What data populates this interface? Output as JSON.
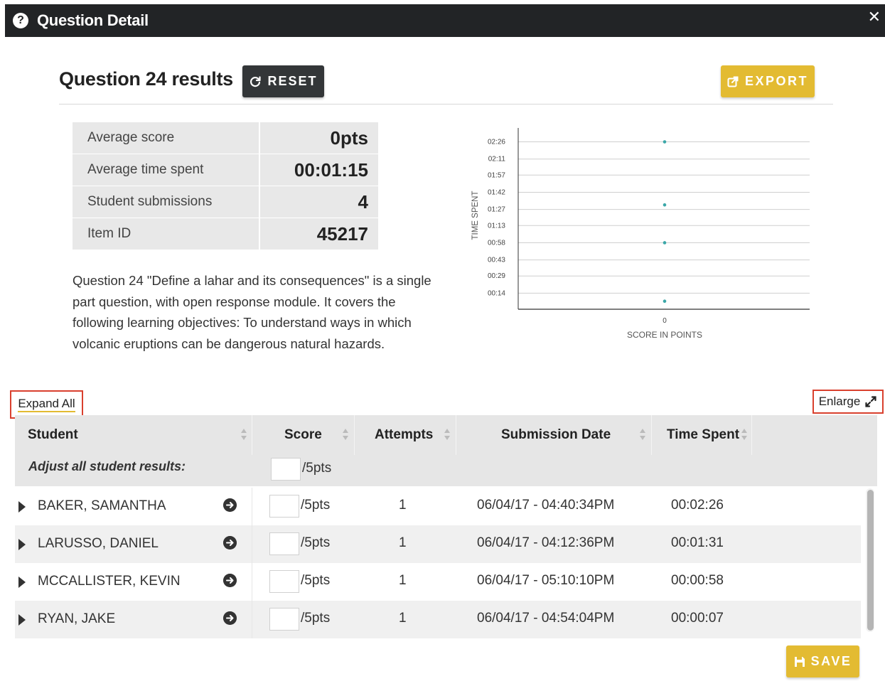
{
  "dialog": {
    "title": "Question Detail",
    "help_icon": "question-circle-icon",
    "close_icon": "close-icon"
  },
  "header": {
    "heading": "Question 24 results",
    "reset_label": "RESET",
    "export_label": "EXPORT"
  },
  "stats": [
    {
      "label": "Average score",
      "value": "0pts"
    },
    {
      "label": "Average time spent",
      "value": "00:01:15"
    },
    {
      "label": "Student submissions",
      "value": "4"
    },
    {
      "label": "Item ID",
      "value": "45217"
    }
  ],
  "description": "Question 24 \"Define a lahar and its consequences\" is a single part question, with open response module. It covers the following learning objectives: To understand ways in which volcanic eruptions can be dangerous natural hazards.",
  "chart_data": {
    "type": "scatter",
    "xlabel": "SCORE IN POINTS",
    "ylabel": "TIME SPENT",
    "x_ticks": [
      "0"
    ],
    "y_ticks": [
      "02:26",
      "02:11",
      "01:57",
      "01:42",
      "01:27",
      "01:13",
      "00:58",
      "00:43",
      "00:29",
      "00:14"
    ],
    "y_tick_seconds": [
      146,
      131,
      117,
      102,
      87,
      73,
      58,
      43,
      29,
      14
    ],
    "points": [
      {
        "x": 0,
        "y": "00:02:26",
        "y_seconds": 146
      },
      {
        "x": 0,
        "y": "00:01:31",
        "y_seconds": 91
      },
      {
        "x": 0,
        "y": "00:00:58",
        "y_seconds": 58
      },
      {
        "x": 0,
        "y": "00:00:07",
        "y_seconds": 7
      }
    ],
    "ylim_seconds": [
      0,
      155
    ],
    "grid": true,
    "color": "#3ba7a8"
  },
  "controls": {
    "expand_all": "Expand All",
    "enlarge": "Enlarge"
  },
  "table": {
    "columns": [
      "Student",
      "Score",
      "Attempts",
      "Submission Date",
      "Time Spent"
    ],
    "adjust_label": "Adjust all student results:",
    "pts_suffix": "/5pts",
    "rows": [
      {
        "student": "BAKER, SAMANTHA",
        "score": "",
        "attempts": "1",
        "date": "06/04/17 - 04:40:34PM",
        "time": "00:02:26"
      },
      {
        "student": "LARUSSO, DANIEL",
        "score": "",
        "attempts": "1",
        "date": "06/04/17 - 04:12:36PM",
        "time": "00:01:31"
      },
      {
        "student": "MCCALLISTER, KEVIN",
        "score": "",
        "attempts": "1",
        "date": "06/04/17 - 05:10:10PM",
        "time": "00:00:58"
      },
      {
        "student": "RYAN, JAKE",
        "score": "",
        "attempts": "1",
        "date": "06/04/17 - 04:54:04PM",
        "time": "00:00:07"
      }
    ]
  },
  "footer": {
    "save_label": "SAVE"
  },
  "colors": {
    "accent": "#e3bb32",
    "dark": "#222426",
    "highlight_border": "#d9402e",
    "chart_point": "#3ba7a8"
  }
}
